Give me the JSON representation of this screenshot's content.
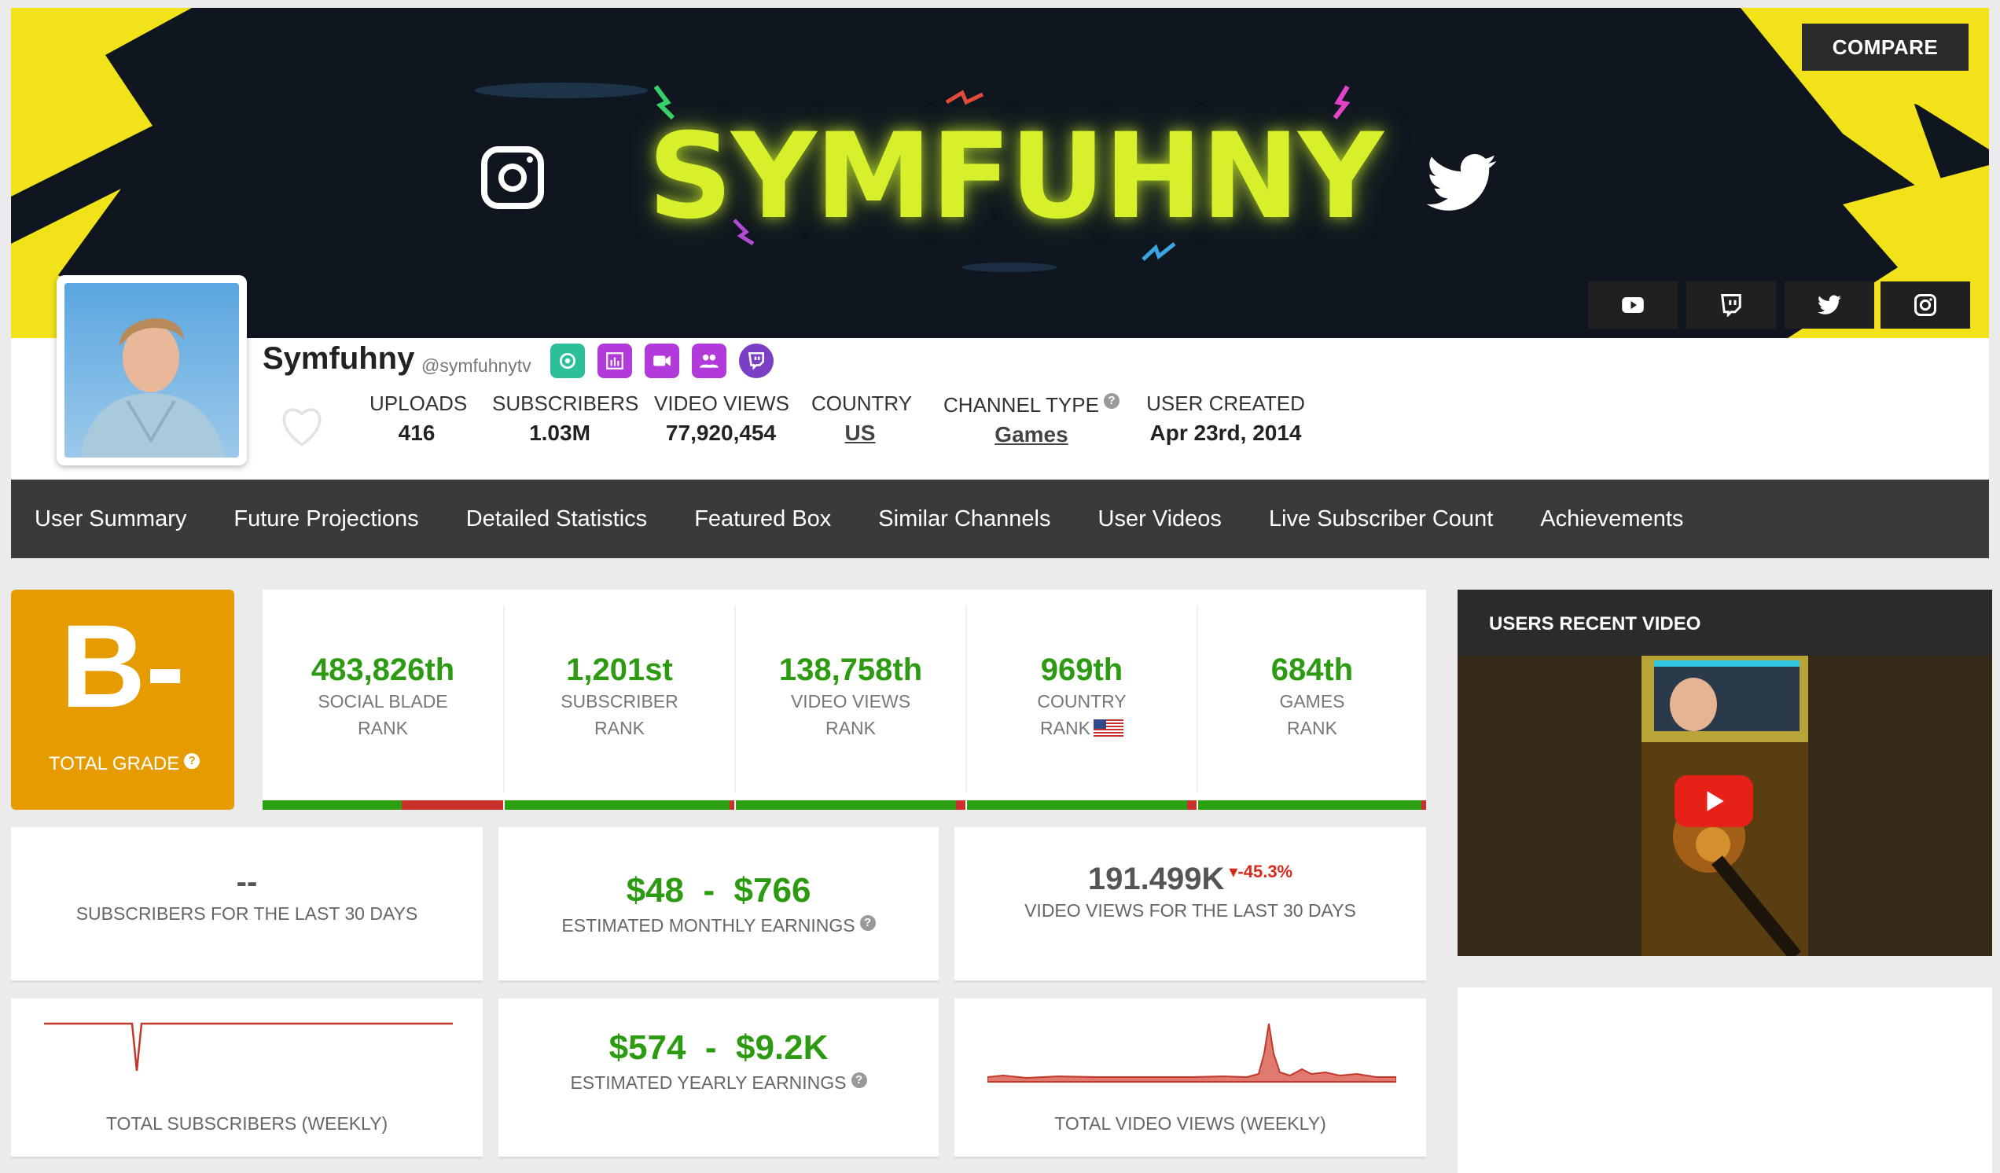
{
  "banner": {
    "title": "SYMFUHNY",
    "compare_label": "COMPARE",
    "social_buttons": [
      "youtube-icon",
      "twitch-icon",
      "twitter-icon",
      "instagram-icon"
    ]
  },
  "profile": {
    "name": "Symfuhny",
    "handle": "@symfuhnytv",
    "badges": [
      {
        "icon": "target-icon",
        "color": "#2bbf9a"
      },
      {
        "icon": "bar-chart-icon",
        "color": "#b23adb"
      },
      {
        "icon": "video-camera-icon",
        "color": "#b23adb"
      },
      {
        "icon": "users-icon",
        "color": "#b23adb"
      },
      {
        "icon": "twitch-icon",
        "color": "#7a3fc4"
      }
    ],
    "stats": {
      "uploads_label": "UPLOADS",
      "uploads": "416",
      "subscribers_label": "SUBSCRIBERS",
      "subscribers": "1.03M",
      "views_label": "VIDEO VIEWS",
      "views": "77,920,454",
      "country_label": "COUNTRY",
      "country": "US",
      "type_label": "CHANNEL TYPE",
      "type": "Games",
      "created_label": "USER CREATED",
      "created": "Apr 23rd, 2014"
    }
  },
  "nav": [
    "User Summary",
    "Future Projections",
    "Detailed Statistics",
    "Featured Box",
    "Similar Channels",
    "User Videos",
    "Live Subscriber Count",
    "Achievements"
  ],
  "grade": {
    "letter": "B-",
    "label": "TOTAL GRADE",
    "color": "#e69c00"
  },
  "ranks": [
    {
      "value": "483,826th",
      "line1": "SOCIAL BLADE",
      "line2": "RANK",
      "bar_fill": 0.58
    },
    {
      "value": "1,201st",
      "line1": "SUBSCRIBER",
      "line2": "RANK",
      "bar_fill": 0.98
    },
    {
      "value": "138,758th",
      "line1": "VIDEO VIEWS",
      "line2": "RANK",
      "bar_fill": 0.96
    },
    {
      "value": "969th",
      "line1": "COUNTRY",
      "line2": "RANK",
      "bar_fill": 0.96
    },
    {
      "value": "684th",
      "line1": "GAMES",
      "line2": "RANK",
      "bar_fill": 0.98
    }
  ],
  "cards": {
    "subs30_value": "--",
    "subs30_label": "SUBSCRIBERS FOR THE LAST 30 DAYS",
    "monthly_low": "$48",
    "monthly_high": "$766",
    "monthly_label": "ESTIMATED MONTHLY EARNINGS",
    "views30_value": "191.499K",
    "views30_change": "-45.3%",
    "views30_label": "VIDEO VIEWS FOR THE LAST 30 DAYS",
    "yearly_low": "$574",
    "yearly_high": "$9.2K",
    "yearly_label": "ESTIMATED YEARLY EARNINGS",
    "subs_weekly_label": "TOTAL SUBSCRIBERS (WEEKLY)",
    "views_weekly_label": "TOTAL VIDEO VIEWS (WEEKLY)",
    "separator": "-"
  },
  "video": {
    "header": "USERS RECENT VIDEO"
  },
  "colors": {
    "accent_green": "#2c9b12",
    "accent_red": "#d9291c",
    "nav_bg": "#3a3a3a",
    "banner_yellow": "#f2e21a"
  }
}
